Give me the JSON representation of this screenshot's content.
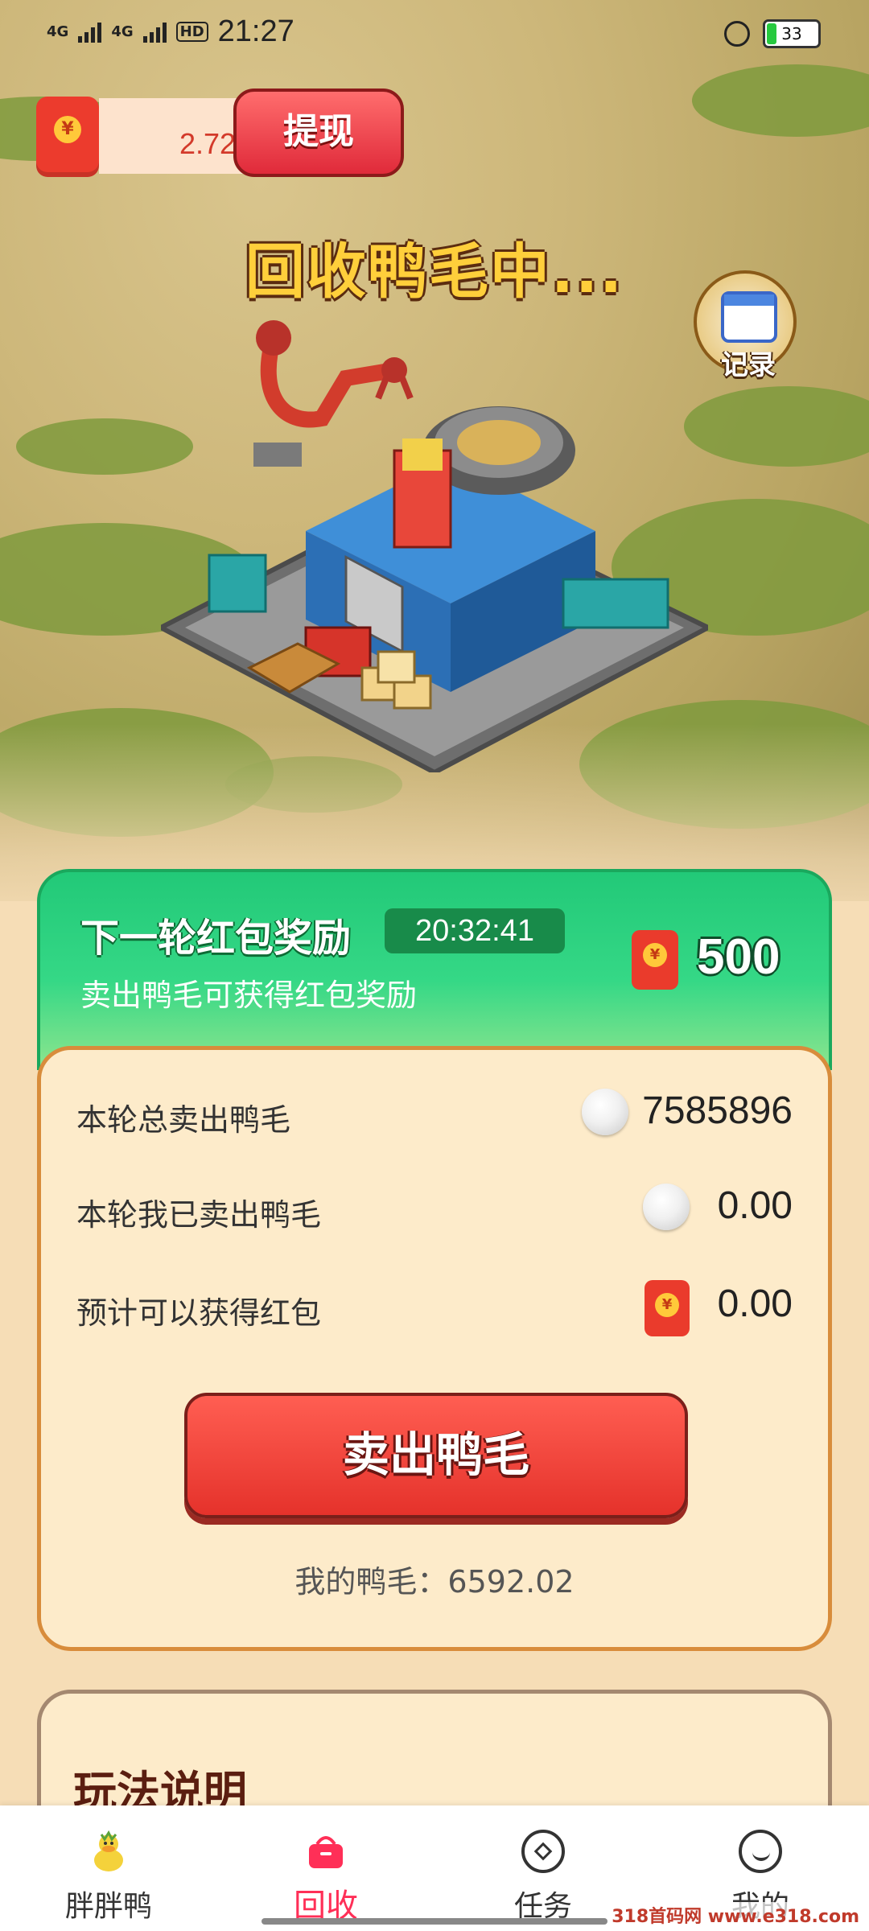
{
  "status_bar": {
    "network_1": "4G",
    "network_2": "4G",
    "hd": "HD",
    "time": "21:27",
    "battery": "33"
  },
  "wallet": {
    "currency_symbol": "¥",
    "balance": "2.72",
    "withdraw_label": "提现"
  },
  "scene": {
    "title": "回收鸭毛中...",
    "record_label": "记录"
  },
  "reward": {
    "title": "下一轮红包奖励",
    "timer": "20:32:41",
    "subtitle": "卖出鸭毛可获得红包奖励",
    "currency_symbol": "¥",
    "amount": "500"
  },
  "stats": [
    {
      "label": "本轮总卖出鸭毛",
      "value": "7585896",
      "icon": "feather-ball-icon"
    },
    {
      "label": "本轮我已卖出鸭毛",
      "value": "0.00",
      "icon": "feather-ball-icon"
    },
    {
      "label": "预计可以获得红包",
      "value": "0.00",
      "icon": "red-envelope-icon"
    }
  ],
  "sell_button": "卖出鸭毛",
  "my_feather": "我的鸭毛：6592.02",
  "rules": {
    "title": "玩法说明"
  },
  "tabs": [
    {
      "label": "胖胖鸭",
      "icon": "duck-icon",
      "active": false
    },
    {
      "label": "回收",
      "icon": "basket-icon",
      "active": true
    },
    {
      "label": "任务",
      "icon": "task-icon",
      "active": false
    },
    {
      "label": "我的",
      "icon": "profile-icon",
      "active": false
    }
  ],
  "watermark": "318首码网 www.e318.com",
  "colors": {
    "accent_red": "#e5322b",
    "accent_green": "#22c978",
    "tab_active": "#ff2f57",
    "card_bg": "#fdebca"
  }
}
